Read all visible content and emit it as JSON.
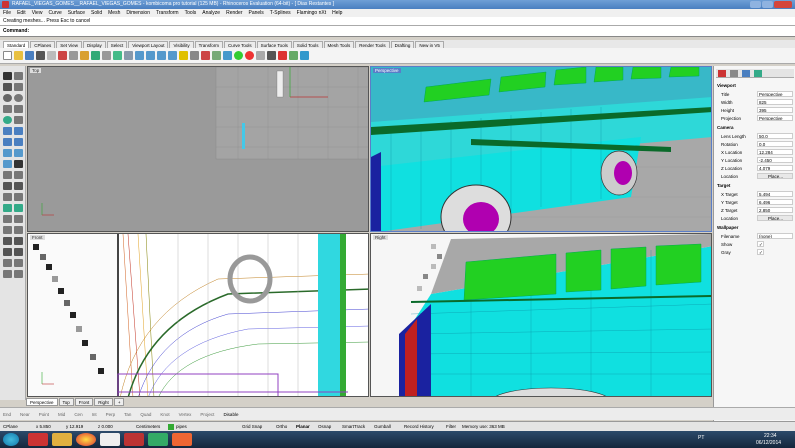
{
  "title_bar": {
    "text": "RAFAEL_VIEGAS_GOMES__RAFAEL_VIEGAS_GOMES - kombicoma pro tutorial (125 MB) - Rhinoceros Evaluation (64-bit) - [ Dias Restantes ]"
  },
  "menu": [
    "File",
    "Edit",
    "View",
    "Curve",
    "Surface",
    "Solid",
    "Mesh",
    "Dimension",
    "Transform",
    "Tools",
    "Analyze",
    "Render",
    "Panels",
    "T-Splines",
    "Flamingo nXt",
    "Help"
  ],
  "status_line": "Creating meshes... Press Esc to cancel",
  "command": {
    "label": "Command:"
  },
  "toolbar_tabs": [
    "Standard",
    "CPlanes",
    "Set View",
    "Display",
    "Select",
    "Viewport Layout",
    "Visibility",
    "Transform",
    "Curve Tools",
    "Surface Tools",
    "Solid Tools",
    "Mesh Tools",
    "Render Tools",
    "Drafting",
    "New in V5"
  ],
  "viewports": {
    "top": "Top",
    "perspective": "Perspective",
    "front": "Front",
    "right": "Right"
  },
  "viewport_tabs": [
    "Perspective",
    "Top",
    "Front",
    "Right",
    "+"
  ],
  "panel": {
    "viewport_section": "Viewport",
    "rows_viewport": [
      {
        "k": "Title",
        "v": "Perspective"
      },
      {
        "k": "Width",
        "v": "825"
      },
      {
        "k": "Height",
        "v": "395"
      },
      {
        "k": "Projection",
        "v": "Perspective"
      }
    ],
    "camera_section": "Camera",
    "rows_camera": [
      {
        "k": "Lens Length",
        "v": "50.0"
      },
      {
        "k": "Rotation",
        "v": "0.0"
      },
      {
        "k": "X Location",
        "v": "12.284"
      },
      {
        "k": "Y Location",
        "v": "-2.450"
      },
      {
        "k": "Z Location",
        "v": "4.079"
      },
      {
        "k": "Location",
        "v": "Place..."
      }
    ],
    "target_section": "Target",
    "rows_target": [
      {
        "k": "X Target",
        "v": "5.494"
      },
      {
        "k": "Y Target",
        "v": "6.496"
      },
      {
        "k": "Z Target",
        "v": "2.850"
      },
      {
        "k": "Location",
        "v": "Place..."
      }
    ],
    "wallpaper_section": "Wallpaper",
    "rows_wallpaper": [
      {
        "k": "Filename",
        "v": "(none)"
      },
      {
        "k": "Show",
        "v": "✓"
      },
      {
        "k": "Gray",
        "v": "✓"
      }
    ]
  },
  "osnap": [
    "End",
    "Near",
    "Point",
    "Mid",
    "Cen",
    "Int",
    "Perp",
    "Tan",
    "Quad",
    "Knot",
    "Vertex",
    "Project",
    "Disable"
  ],
  "statusbar": {
    "cplane": "CPlane",
    "x": "x 5.850",
    "y": "y 12.919",
    "z": "z 0.000",
    "units": "Centimeters",
    "layer": "pipes",
    "toggles": [
      "Grid Snap",
      "Ortho",
      "Planar",
      "Osnap",
      "SmartTrack",
      "Gumball",
      "Record History",
      "Filter"
    ],
    "memory": "Memory use: 363 MB"
  },
  "clock": {
    "time": "22:34",
    "date": "06/12/2014",
    "lang": "PT"
  },
  "colors": {
    "accent": "#4a7fc0",
    "body": "#00e0e0",
    "windows": "#22d022",
    "wheel": "#b000b0"
  }
}
